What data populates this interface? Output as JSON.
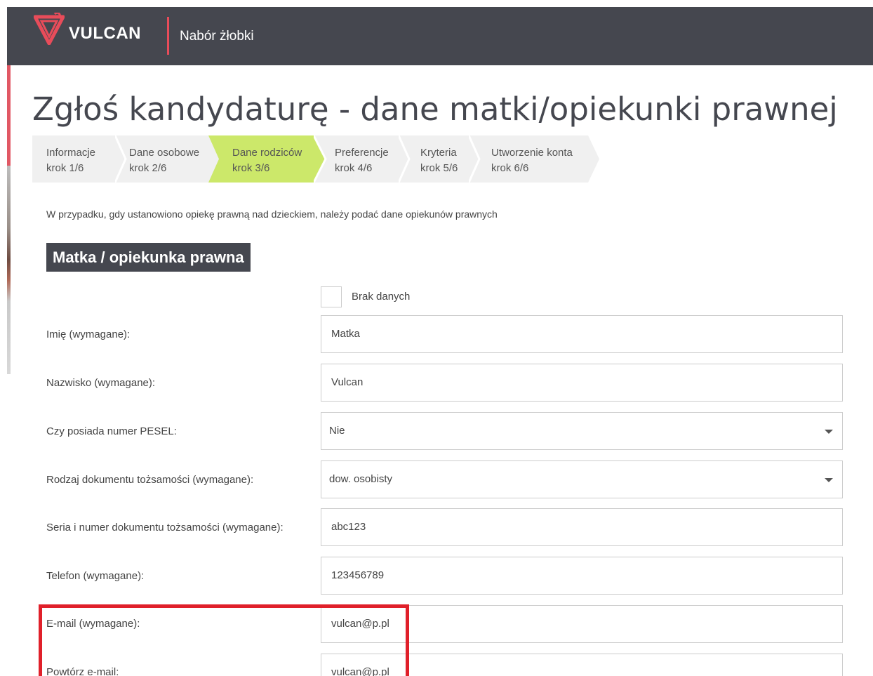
{
  "header": {
    "brand": "VULCAN",
    "app_name": "Nabór żłobki"
  },
  "page_title": "Zgłoś kandydaturę - dane matki/opiekunki prawnej",
  "steps": [
    {
      "name": "Informacje",
      "step": "krok 1/6",
      "active": false
    },
    {
      "name": "Dane osobowe",
      "step": "krok 2/6",
      "active": false
    },
    {
      "name": "Dane rodziców",
      "step": "krok 3/6",
      "active": true
    },
    {
      "name": "Preferencje",
      "step": "krok 4/6",
      "active": false
    },
    {
      "name": "Kryteria",
      "step": "krok 5/6",
      "active": false
    },
    {
      "name": "Utworzenie konta",
      "step": "krok 6/6",
      "active": false
    }
  ],
  "info_text": "W przypadku, gdy ustanowiono opiekę prawną nad dzieckiem, należy podać dane opiekunów prawnych",
  "section_title": "Matka / opiekunka prawna",
  "no_data": {
    "label": "Brak danych",
    "checked": false
  },
  "form": {
    "first_name": {
      "label": "Imię (wymagane):",
      "value": "Matka"
    },
    "last_name": {
      "label": "Nazwisko (wymagane):",
      "value": "Vulcan"
    },
    "has_pesel": {
      "label": "Czy posiada numer PESEL:",
      "value": "Nie"
    },
    "doc_type": {
      "label": "Rodzaj dokumentu tożsamości (wymagane):",
      "value": "dow. osobisty"
    },
    "doc_number": {
      "label": "Seria i numer dokumentu tożsamości (wymagane):",
      "value": "abc123"
    },
    "phone": {
      "label": "Telefon (wymagane):",
      "value": "123456789"
    },
    "email": {
      "label": "E-mail (wymagane):",
      "value": "vulcan@p.pl"
    },
    "email_repeat": {
      "label": "Powtórz e-mail:",
      "value": "vulcan@p.pl"
    }
  },
  "colors": {
    "header_bg": "#45474f",
    "accent_red": "#e84c5a",
    "active_step": "#cce86a",
    "step_bg": "#f0f0f0",
    "highlight": "#e0202a"
  }
}
